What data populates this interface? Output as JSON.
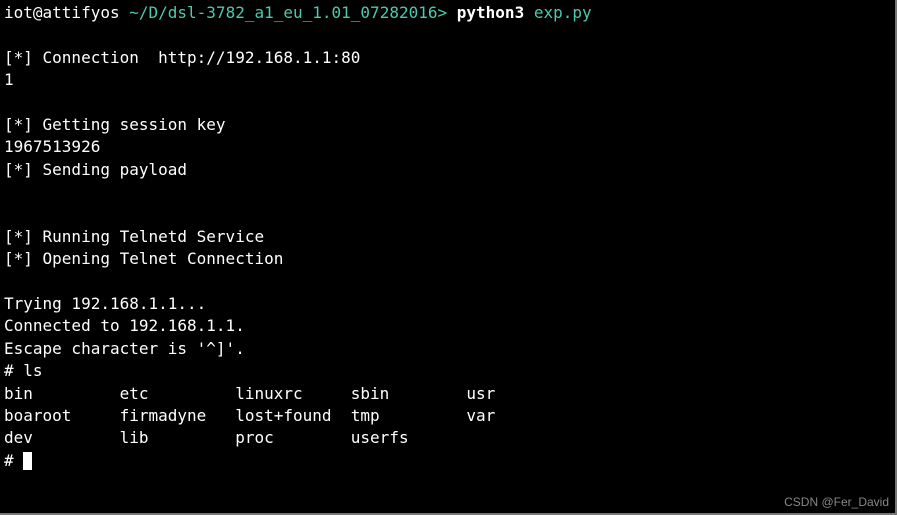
{
  "prompt": {
    "user": "iot@attifyos",
    "separator1": " ",
    "path": "~/D/dsl-3782_a1_eu_1.01_07282016",
    "arrow": ">",
    "space": " ",
    "command": "python3",
    "arg": "exp.py"
  },
  "output": {
    "blank1": "",
    "conn_line": "[*] Connection  http://192.168.1.1:80",
    "one": "1",
    "blank2": "",
    "session_key": "[*] Getting session key",
    "session_val": "1967513926",
    "sending": "[*] Sending payload",
    "blank3": "",
    "blank4": "",
    "telnetd": "[*] Running Telnetd Service",
    "telnet_conn": "[*] Opening Telnet Connection",
    "blank5": "",
    "trying": "Trying 192.168.1.1...",
    "connected": "Connected to 192.168.1.1.",
    "escape": "Escape character is '^]'.",
    "ls_cmd": "# ls",
    "ls_row1": "bin         etc         linuxrc     sbin        usr",
    "ls_row2": "boaroot     firmadyne   lost+found  tmp         var",
    "ls_row3": "dev         lib         proc        userfs",
    "final_prompt": "# "
  },
  "watermark": "CSDN @Fer_David"
}
